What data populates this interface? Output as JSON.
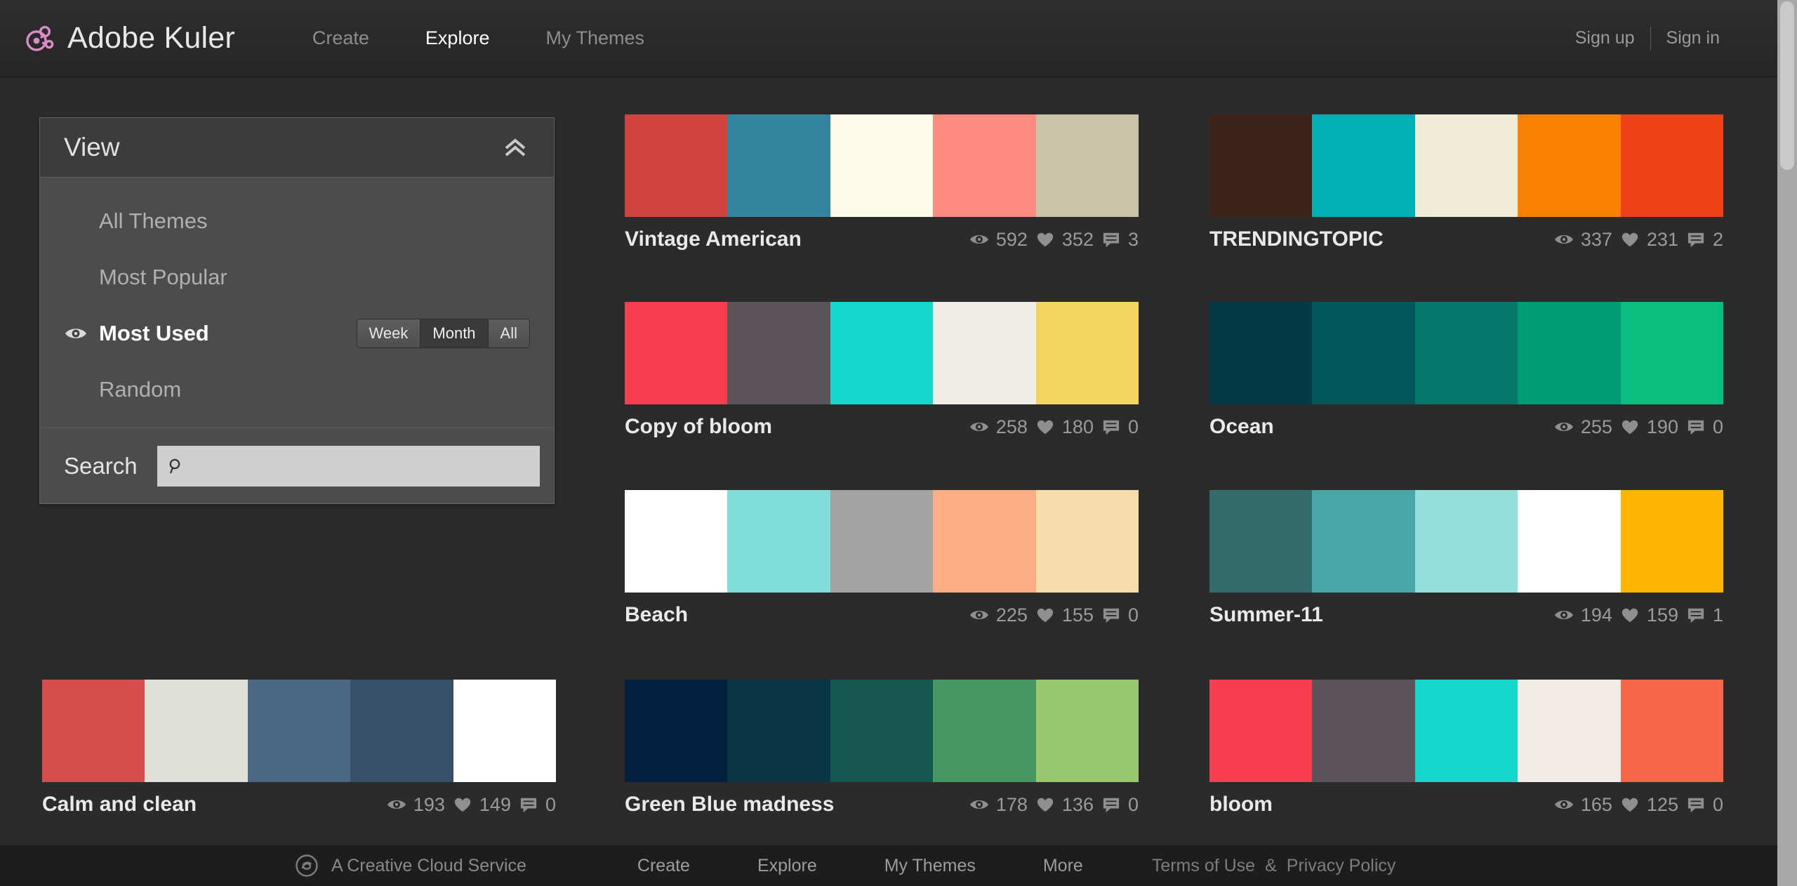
{
  "header": {
    "brand": "Adobe Kuler",
    "logo_icon": "kuler-logo-icon",
    "logo_color": "#d98cc8",
    "nav": [
      {
        "label": "Create",
        "active": false
      },
      {
        "label": "Explore",
        "active": true
      },
      {
        "label": "My Themes",
        "active": false
      }
    ],
    "auth": [
      {
        "label": "Sign up"
      },
      {
        "label": "Sign in"
      }
    ]
  },
  "view_panel": {
    "title": "View",
    "collapse_icon": "chevron-double-up-icon",
    "options": [
      {
        "label": "All Themes",
        "selected": false
      },
      {
        "label": "Most Popular",
        "selected": false
      },
      {
        "label": "Most Used",
        "selected": true
      },
      {
        "label": "Random",
        "selected": false
      }
    ],
    "range_toggle": {
      "options": [
        "Week",
        "Month",
        "All"
      ],
      "selected": "Month"
    },
    "search": {
      "label": "Search",
      "icon": "search-icon",
      "value": "",
      "placeholder": ""
    }
  },
  "stat_icons": {
    "views": "eye-icon",
    "likes": "heart-icon",
    "comments": "comment-icon"
  },
  "themes": [
    {
      "title": "Vintage American",
      "views": "592",
      "likes": "352",
      "comments": "3",
      "colors": [
        "#d1433c",
        "#33849e",
        "#fffbe9",
        "#fd8b80",
        "#cbc3a7"
      ]
    },
    {
      "title": "TRENDINGTOPIC",
      "views": "337",
      "likes": "231",
      "comments": "2",
      "colors": [
        "#3d2217",
        "#01b0b5",
        "#f0ebd7",
        "#f98000",
        "#ef4118"
      ]
    },
    {
      "title": "Copy of bloom",
      "views": "258",
      "likes": "180",
      "comments": "0",
      "colors": [
        "#f73e4f",
        "#5a5359",
        "#16d6cd",
        "#f0ece7",
        "#f4d55f"
      ]
    },
    {
      "title": "Ocean",
      "views": "255",
      "likes": "190",
      "comments": "0",
      "colors": [
        "#023b45",
        "#01585c",
        "#07786d",
        "#009c74",
        "#0cbd80"
      ]
    },
    {
      "title": "Beach",
      "views": "225",
      "likes": "155",
      "comments": "0",
      "colors": [
        "#ffffff",
        "#81ddda",
        "#a3a3a3",
        "#fdad83",
        "#f5dcab"
      ]
    },
    {
      "title": "Summer-11",
      "views": "194",
      "likes": "159",
      "comments": "1",
      "colors": [
        "#336a6c",
        "#48a7a6",
        "#94dedb",
        "#ffffff",
        "#feb603"
      ]
    },
    {
      "title": "Calm and clean",
      "views": "193",
      "likes": "149",
      "comments": "0",
      "colors": [
        "#d64e4c",
        "#dedfd9",
        "#4c6782",
        "#36506a",
        "#ffffff"
      ]
    },
    {
      "title": "Green Blue madness",
      "views": "178",
      "likes": "136",
      "comments": "0",
      "colors": [
        "#04203f",
        "#0a3545",
        "#15564f",
        "#479762",
        "#9ac772"
      ]
    },
    {
      "title": "bloom",
      "views": "165",
      "likes": "125",
      "comments": "0",
      "colors": [
        "#f73e4f",
        "#5a5359",
        "#16d6cd",
        "#f1ece7",
        "#f86648"
      ]
    }
  ],
  "footer": {
    "cc_icon": "creative-cloud-icon",
    "cc_text": "A Creative Cloud Service",
    "nav": [
      {
        "label": "Create"
      },
      {
        "label": "Explore"
      },
      {
        "label": "My Themes"
      },
      {
        "label": "More"
      }
    ],
    "terms_label": "Terms of Use",
    "amp": "&",
    "privacy_label": "Privacy Policy"
  }
}
